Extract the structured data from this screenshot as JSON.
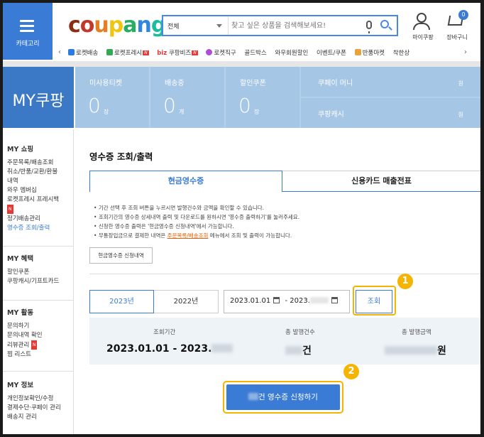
{
  "header": {
    "category_label": "카테고리",
    "logo_text": "coupang",
    "search": {
      "scope": "전체",
      "placeholder": "찾고 싶은 상품을 검색해보세요!"
    },
    "mypage_label": "마이쿠팡",
    "cart_label": "장바구니",
    "cart_count": "0",
    "category_bar": [
      {
        "label": "로켓배송",
        "icon_color": "#2c7be5"
      },
      {
        "label": "로켓프레시",
        "icon_color": "#35a853",
        "new": true
      },
      {
        "label": "쿠팡비즈",
        "prefix": "biz",
        "new": true
      },
      {
        "label": "로켓직구",
        "icon_color": "#b04dd3"
      },
      {
        "label": "골드박스"
      },
      {
        "label": "와우회원할인"
      },
      {
        "label": "이벤트/쿠폰"
      },
      {
        "label": "반품마켓",
        "icon_color": "#e8a33b"
      },
      {
        "label": "착한상"
      }
    ],
    "new_badge": "N"
  },
  "my_coupang": {
    "title": "MY쿠팡",
    "stats": [
      {
        "label": "미사용티켓",
        "value": "0",
        "unit": "장"
      },
      {
        "label": "배송중",
        "value": "0",
        "unit": "개"
      },
      {
        "label": "할인쿠폰",
        "value": "0",
        "unit": "장"
      }
    ],
    "cash": [
      {
        "label": "쿠페이 머니",
        "unit": "원"
      },
      {
        "label": "쿠팡캐시",
        "unit": "원"
      }
    ]
  },
  "sidebar": {
    "groups": [
      {
        "title": "MY 쇼핑",
        "items": [
          "주문목록/배송조회",
          "취소/반품/교환/환불",
          "내역",
          "와우 멤버십",
          "로켓프레시 프레시백",
          "정기배송관리",
          "영수증 조회/출력"
        ],
        "active_index": 6
      },
      {
        "title": "MY 혜택",
        "items": [
          "할인쿠폰",
          "쿠팡캐시/기프트카드"
        ]
      },
      {
        "title": "MY 활동",
        "items": [
          "문의하기",
          "문의내역 확인",
          "리뷰관리",
          "찜 리스트"
        ]
      },
      {
        "title": "MY 정보",
        "items": [
          "개인정보확인/수정",
          "결제수단·쿠페이 관리",
          "배송지 관리"
        ]
      }
    ]
  },
  "main": {
    "title": "영수증 조회/출력",
    "tabs": [
      "현금영수증",
      "신용카드 매출전표"
    ],
    "notes": [
      "기간 선택 후 조회 버튼을 누르시면 발행건수와 금액을 확인할 수 있습니다.",
      "조회기간의 영수증 상세내역 출력 및 다운로드를 원하시면 '영수증 출력하기'를 눌러주세요.",
      "신청한 영수증 출력은 '현금영수증 신청내역'에서 가능합니다."
    ],
    "note_last_prefix": "무통장입금으로 결제한 내역은 ",
    "note_last_link": "주문목록/배송조회",
    "note_last_suffix": " 메뉴에서 조회 및 출력이 가능합니다.",
    "history_button": "현금영수증 신청내역",
    "years": [
      "2023년",
      "2022년"
    ],
    "date_from": "2023.01.01",
    "date_sep": "-",
    "date_to": "2023.",
    "lookup_button": "조회",
    "summary": {
      "period_label": "조회기간",
      "period_value": "2023.01.01 - 2023.",
      "count_label": "총 발행건수",
      "count_suffix": "건",
      "amount_label": "총 발행금액",
      "amount_suffix": "원"
    },
    "apply_button": "건 영수증 신청하기",
    "callouts": [
      "1",
      "2"
    ]
  }
}
